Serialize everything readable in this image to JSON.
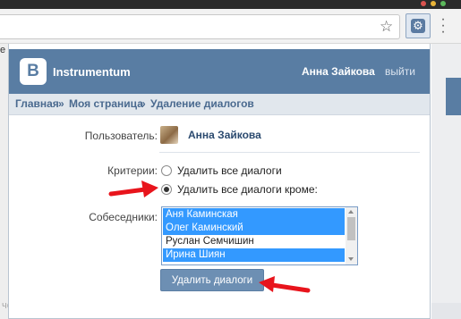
{
  "browser": {
    "behind_page_text_top": "е",
    "behind_page_text_bottom": "чера"
  },
  "popup": {
    "app_title": "Instrumentum",
    "logo_letter": "B",
    "user_name": "Анна Зайкова",
    "logout_label": "выйти",
    "breadcrumbs": [
      "Главная",
      "»",
      "Моя страница",
      "»",
      "Удаление диалогов"
    ]
  },
  "form": {
    "user_label": "Пользователь:",
    "user_value": "Анна Зайкова",
    "criteria_label": "Критерии:",
    "criteria_options": [
      {
        "label": "Удалить все диалоги",
        "checked": false
      },
      {
        "label": "Удалить все диалоги кроме:",
        "checked": true
      }
    ],
    "interlocutors_label": "Собеседники:",
    "interlocutors": [
      {
        "name": "Аня Каминская",
        "selected": true
      },
      {
        "name": "Олег Каминский",
        "selected": true
      },
      {
        "name": "Руслан Семчишин",
        "selected": false
      },
      {
        "name": "Ирина Шиян",
        "selected": true
      }
    ],
    "submit_label": "Удалить диалоги"
  },
  "colors": {
    "header": "#597da3",
    "breadcrumb_bg": "#e1e7ed",
    "selection": "#3399ff",
    "button": "#6d8fb3",
    "annotation_arrow": "#e8141c"
  },
  "icons": [
    "star-icon",
    "extension-gear-icon",
    "menu-icon",
    "vk-logo-icon"
  ]
}
